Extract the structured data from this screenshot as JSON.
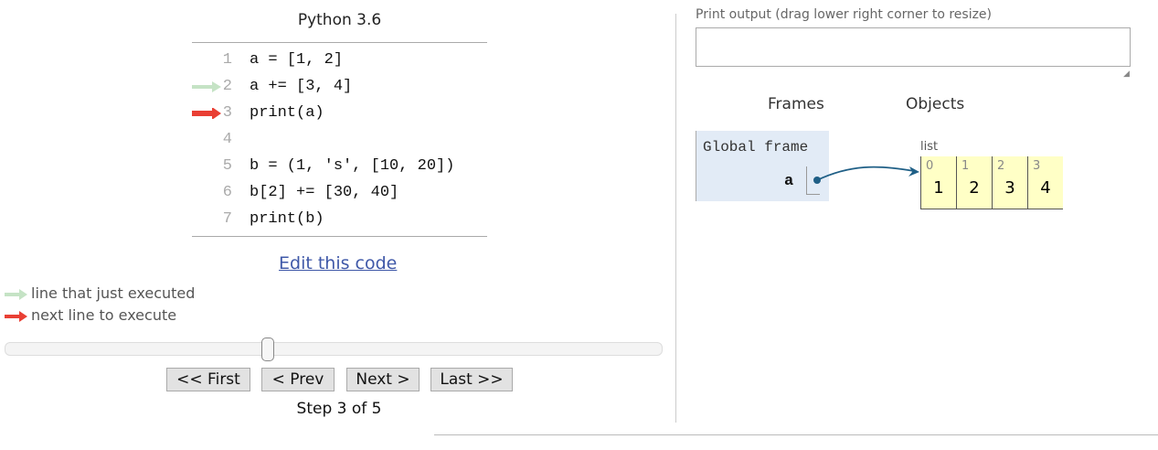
{
  "title": "Python 3.6",
  "code": [
    {
      "n": "1",
      "text": "a = [1, 2]"
    },
    {
      "n": "2",
      "text": "a += [3, 4]"
    },
    {
      "n": "3",
      "text": "print(a)"
    },
    {
      "n": "4",
      "text": ""
    },
    {
      "n": "5",
      "text": "b = (1, 's', [10, 20])"
    },
    {
      "n": "6",
      "text": "b[2] += [30, 40]"
    },
    {
      "n": "7",
      "text": "print(b)"
    }
  ],
  "prev_line": 2,
  "next_line": 3,
  "edit_link": "Edit this code",
  "legend": {
    "prev": "line that just executed",
    "next": "next line to execute"
  },
  "colors": {
    "prev_arrow": "#c5e3c5",
    "next_arrow": "#e93f34",
    "pointer": "#1f5f86"
  },
  "slider": {
    "fraction": 0.4
  },
  "buttons": {
    "first": "<< First",
    "prev": "< Prev",
    "next": "Next >",
    "last": "Last >>"
  },
  "step": "Step 3 of 5",
  "print_output": {
    "label": "Print output (drag lower right corner to resize)",
    "value": ""
  },
  "frames_header": "Frames",
  "objects_header": "Objects",
  "frame": {
    "name": "Global frame",
    "var": "a"
  },
  "list": {
    "label": "list",
    "items": [
      {
        "i": "0",
        "v": "1"
      },
      {
        "i": "1",
        "v": "2"
      },
      {
        "i": "2",
        "v": "3"
      },
      {
        "i": "3",
        "v": "4"
      }
    ]
  }
}
